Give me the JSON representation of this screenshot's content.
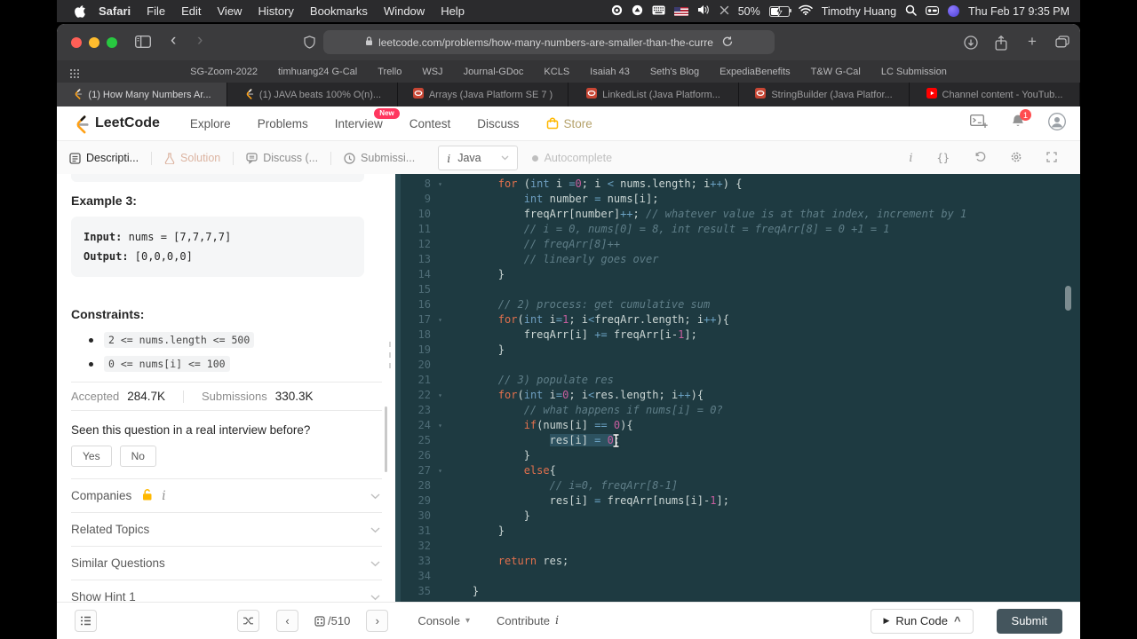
{
  "colors": {
    "accent_orange": "#FFA116",
    "badge_pink": "#ff375f",
    "submit_bg": "#44555d",
    "editor_bg": "#1e3a41"
  },
  "menubar": {
    "items": [
      "Safari",
      "File",
      "Edit",
      "View",
      "History",
      "Bookmarks",
      "Window",
      "Help"
    ],
    "battery": "50%",
    "user": "Timothy Huang",
    "clock": "Thu Feb 17 9:35 PM"
  },
  "browser": {
    "url": "leetcode.com/problems/how-many-numbers-are-smaller-than-the-curre",
    "bookmarks": [
      "SG-Zoom-2022",
      "timhuang24 G-Cal",
      "Trello",
      "WSJ",
      "Journal-GDoc",
      "KCLS",
      "Isaiah 43",
      "Seth's Blog",
      "ExpediaBenefits",
      "T&W G-Cal",
      "LC Submission"
    ],
    "tabs": [
      {
        "label": "(1) How Many Numbers Ar...",
        "icon": "leetcode-favicon",
        "active": true
      },
      {
        "label": "(1) JAVA beats 100% O(n)...",
        "icon": "leetcode-favicon",
        "active": false
      },
      {
        "label": "Arrays (Java Platform SE 7 )",
        "icon": "oracle-favicon",
        "active": false
      },
      {
        "label": "LinkedList (Java Platform...",
        "icon": "oracle-favicon",
        "active": false
      },
      {
        "label": "StringBuilder (Java Platfor...",
        "icon": "oracle-favicon",
        "active": false
      },
      {
        "label": "Channel content - YouTub...",
        "icon": "youtube-favicon",
        "active": false
      }
    ]
  },
  "site_header": {
    "logo_text": "LeetCode",
    "nav": [
      {
        "label": "Explore"
      },
      {
        "label": "Problems"
      },
      {
        "label": "Interview",
        "badge": "New"
      },
      {
        "label": "Contest"
      },
      {
        "label": "Discuss"
      }
    ],
    "store_label": "Store",
    "notification_count": "1"
  },
  "panel_tabs": {
    "description": "Descripti...",
    "solution": "Solution",
    "discuss": "Discuss (...",
    "submissions": "Submissi...",
    "language": "Java",
    "autocomplete": "Autocomplete"
  },
  "problem": {
    "example_title": "Example 3:",
    "input_label": "Input:",
    "input_value": " nums = [7,7,7,7]",
    "output_label": "Output:",
    "output_value": " [0,0,0,0]",
    "constraints_title": "Constraints:",
    "constraints": [
      "2 <= nums.length <= 500",
      "0 <= nums[i] <= 100"
    ],
    "accepted_label": "Accepted",
    "accepted_value": "284.7K",
    "submissions_label": "Submissions",
    "submissions_value": "330.3K",
    "interview_question": "Seen this question in a real interview before?",
    "yes": "Yes",
    "no": "No",
    "sections": [
      {
        "label": "Companies",
        "lock": true,
        "info": true
      },
      {
        "label": "Related Topics"
      },
      {
        "label": "Similar Questions"
      },
      {
        "label": "Show Hint 1"
      }
    ]
  },
  "editor": {
    "lines": [
      {
        "n": "8",
        "fold": true,
        "ind": 8,
        "tokens": [
          {
            "t": "for",
            "c": "k"
          },
          {
            "t": " (",
            "c": "p"
          },
          {
            "t": "int",
            "c": "t"
          },
          {
            "t": " i ",
            "c": "p"
          },
          {
            "t": "=",
            "c": "o"
          },
          {
            "t": "0",
            "c": "n"
          },
          {
            "t": "; i ",
            "c": "p"
          },
          {
            "t": "<",
            "c": "o"
          },
          {
            "t": " nums.length; i",
            "c": "p"
          },
          {
            "t": "++",
            "c": "o"
          },
          {
            "t": ") {",
            "c": "p"
          }
        ]
      },
      {
        "n": "9",
        "ind": 12,
        "tokens": [
          {
            "t": "int",
            "c": "t"
          },
          {
            "t": " number ",
            "c": "p"
          },
          {
            "t": "=",
            "c": "o"
          },
          {
            "t": " nums[i];",
            "c": "p"
          }
        ]
      },
      {
        "n": "10",
        "ind": 12,
        "tokens": [
          {
            "t": "freqArr[number]",
            "c": "p"
          },
          {
            "t": "++",
            "c": "o"
          },
          {
            "t": "; ",
            "c": "p"
          },
          {
            "t": "// whatever value is at that index, increment by 1",
            "c": "c"
          }
        ]
      },
      {
        "n": "11",
        "ind": 12,
        "tokens": [
          {
            "t": "// i = 0, nums[0] = 8, int result = freqArr[8] = 0 +1 = 1",
            "c": "c"
          }
        ]
      },
      {
        "n": "12",
        "ind": 12,
        "tokens": [
          {
            "t": "// freqArr[8]++",
            "c": "c"
          }
        ]
      },
      {
        "n": "13",
        "ind": 12,
        "tokens": [
          {
            "t": "// linearly goes over",
            "c": "c"
          }
        ]
      },
      {
        "n": "14",
        "ind": 8,
        "tokens": [
          {
            "t": "}",
            "c": "p"
          }
        ]
      },
      {
        "n": "15",
        "tokens": []
      },
      {
        "n": "16",
        "ind": 8,
        "tokens": [
          {
            "t": "// 2) process: get cumulative sum",
            "c": "c"
          }
        ]
      },
      {
        "n": "17",
        "fold": true,
        "ind": 8,
        "tokens": [
          {
            "t": "for",
            "c": "k"
          },
          {
            "t": "(",
            "c": "p"
          },
          {
            "t": "int",
            "c": "t"
          },
          {
            "t": " i",
            "c": "p"
          },
          {
            "t": "=",
            "c": "o"
          },
          {
            "t": "1",
            "c": "n"
          },
          {
            "t": "; i",
            "c": "p"
          },
          {
            "t": "<",
            "c": "o"
          },
          {
            "t": "freqArr.length; i",
            "c": "p"
          },
          {
            "t": "++",
            "c": "o"
          },
          {
            "t": "){",
            "c": "p"
          }
        ]
      },
      {
        "n": "18",
        "ind": 12,
        "tokens": [
          {
            "t": "freqArr[i] ",
            "c": "p"
          },
          {
            "t": "+=",
            "c": "o"
          },
          {
            "t": " freqArr[i-",
            "c": "p"
          },
          {
            "t": "1",
            "c": "n"
          },
          {
            "t": "];",
            "c": "p"
          }
        ]
      },
      {
        "n": "19",
        "ind": 8,
        "tokens": [
          {
            "t": "}",
            "c": "p"
          }
        ]
      },
      {
        "n": "20",
        "tokens": []
      },
      {
        "n": "21",
        "ind": 8,
        "tokens": [
          {
            "t": "// 3) populate res",
            "c": "c"
          }
        ]
      },
      {
        "n": "22",
        "fold": true,
        "ind": 8,
        "tokens": [
          {
            "t": "for",
            "c": "k"
          },
          {
            "t": "(",
            "c": "p"
          },
          {
            "t": "int",
            "c": "t"
          },
          {
            "t": " i",
            "c": "p"
          },
          {
            "t": "=",
            "c": "o"
          },
          {
            "t": "0",
            "c": "n"
          },
          {
            "t": "; i",
            "c": "p"
          },
          {
            "t": "<",
            "c": "o"
          },
          {
            "t": "res.length; i",
            "c": "p"
          },
          {
            "t": "++",
            "c": "o"
          },
          {
            "t": "){",
            "c": "p"
          }
        ]
      },
      {
        "n": "23",
        "ind": 12,
        "tokens": [
          {
            "t": "// what happens if nums[i] = 0?",
            "c": "c"
          }
        ]
      },
      {
        "n": "24",
        "fold": true,
        "ind": 12,
        "tokens": [
          {
            "t": "if",
            "c": "k"
          },
          {
            "t": "(nums[i] ",
            "c": "p"
          },
          {
            "t": "==",
            "c": "o"
          },
          {
            "t": " ",
            "c": "p"
          },
          {
            "t": "0",
            "c": "n"
          },
          {
            "t": "){",
            "c": "p"
          }
        ]
      },
      {
        "n": "25",
        "ind": 16,
        "cursor": true,
        "tokens": [
          {
            "t": "res[i] ",
            "c": "p",
            "h": true
          },
          {
            "t": "=",
            "c": "o",
            "h": true
          },
          {
            "t": " ",
            "c": "p",
            "h": true
          },
          {
            "t": "0",
            "c": "n",
            "h": true
          },
          {
            "t": ";",
            "c": "p"
          }
        ]
      },
      {
        "n": "26",
        "ind": 12,
        "tokens": [
          {
            "t": "}",
            "c": "p"
          }
        ]
      },
      {
        "n": "27",
        "fold": true,
        "ind": 12,
        "tokens": [
          {
            "t": "else",
            "c": "k"
          },
          {
            "t": "{",
            "c": "p"
          }
        ]
      },
      {
        "n": "28",
        "ind": 16,
        "tokens": [
          {
            "t": "// i=0, freqArr[8-1]",
            "c": "c"
          }
        ]
      },
      {
        "n": "29",
        "ind": 16,
        "tokens": [
          {
            "t": "res[i] ",
            "c": "p"
          },
          {
            "t": "=",
            "c": "o"
          },
          {
            "t": " freqArr[nums[i]-",
            "c": "p"
          },
          {
            "t": "1",
            "c": "n"
          },
          {
            "t": "];",
            "c": "p"
          }
        ]
      },
      {
        "n": "30",
        "ind": 12,
        "tokens": [
          {
            "t": "}",
            "c": "p"
          }
        ]
      },
      {
        "n": "31",
        "ind": 8,
        "tokens": [
          {
            "t": "}",
            "c": "p"
          }
        ]
      },
      {
        "n": "32",
        "tokens": []
      },
      {
        "n": "33",
        "ind": 8,
        "tokens": [
          {
            "t": "return",
            "c": "k"
          },
          {
            "t": " res;",
            "c": "p"
          }
        ]
      },
      {
        "n": "34",
        "tokens": []
      },
      {
        "n": "35",
        "ind": 4,
        "tokens": [
          {
            "t": "}",
            "c": "p"
          }
        ]
      }
    ]
  },
  "bottombar": {
    "problem_count": "/510",
    "console_label": "Console",
    "contribute_label": "Contribute",
    "run_code_label": "Run Code",
    "submit_label": "Submit"
  }
}
